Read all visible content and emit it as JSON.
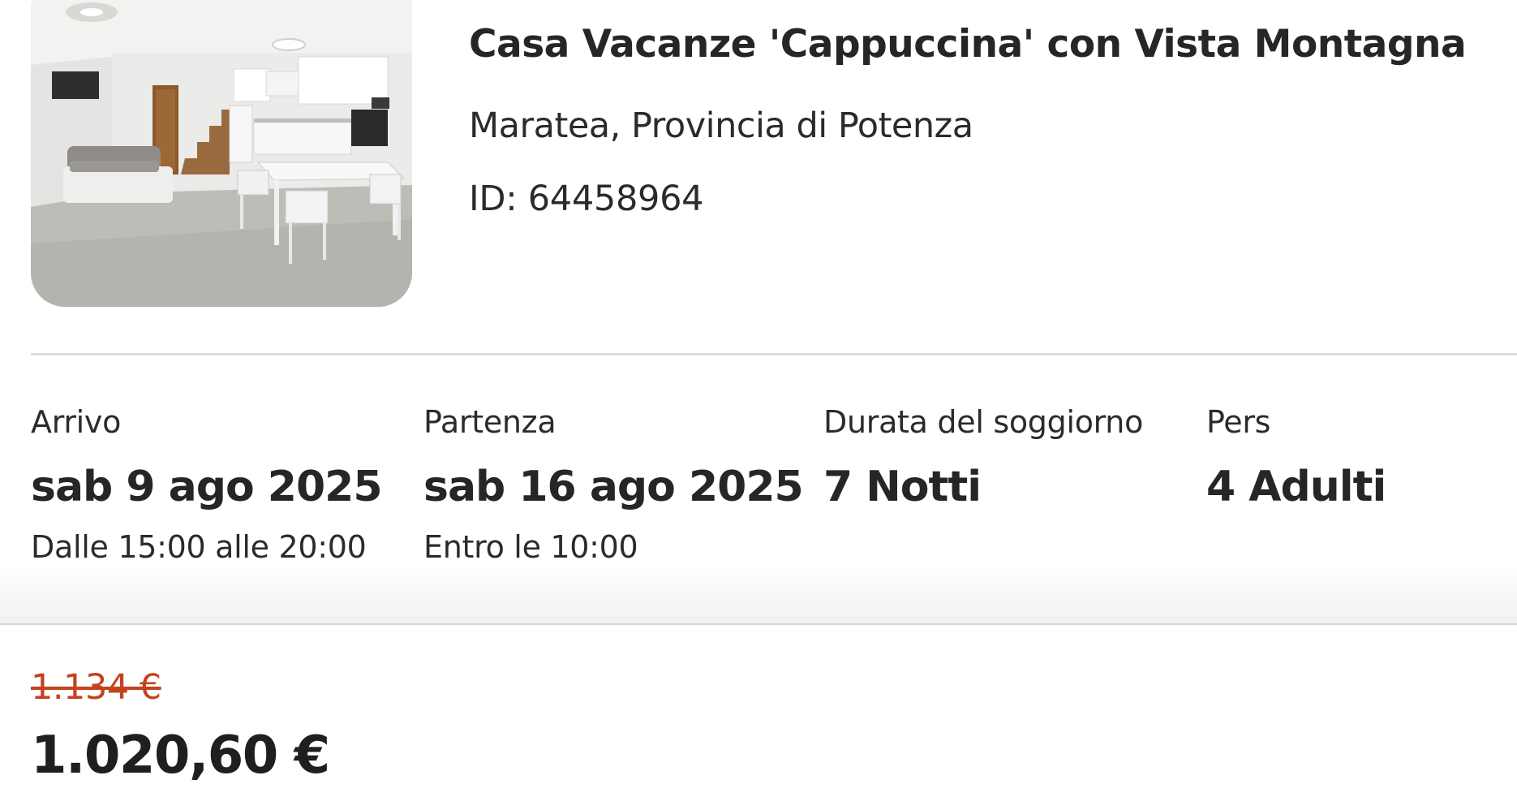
{
  "listing": {
    "title": "Casa Vacanze 'Cappuccina' con Vista Montagna",
    "location": "Maratea, Provincia di Potenza",
    "id_text": "ID: 64458964"
  },
  "stay": {
    "arrival": {
      "label": "Arrivo",
      "date": "sab 9 ago 2025",
      "time": "Dalle 15:00 alle 20:00"
    },
    "departure": {
      "label": "Partenza",
      "date": "sab 16 ago 2025",
      "time": "Entro le 10:00"
    },
    "duration": {
      "label": "Durata del soggiorno",
      "value": "7 Notti"
    },
    "guests": {
      "label": "Pers",
      "value": "4 Adulti"
    }
  },
  "price": {
    "original": "1.134 €",
    "current": "1.020,60 €"
  },
  "colors": {
    "strikethrough_price": "#c4431c",
    "divider": "#dcdcdc"
  }
}
